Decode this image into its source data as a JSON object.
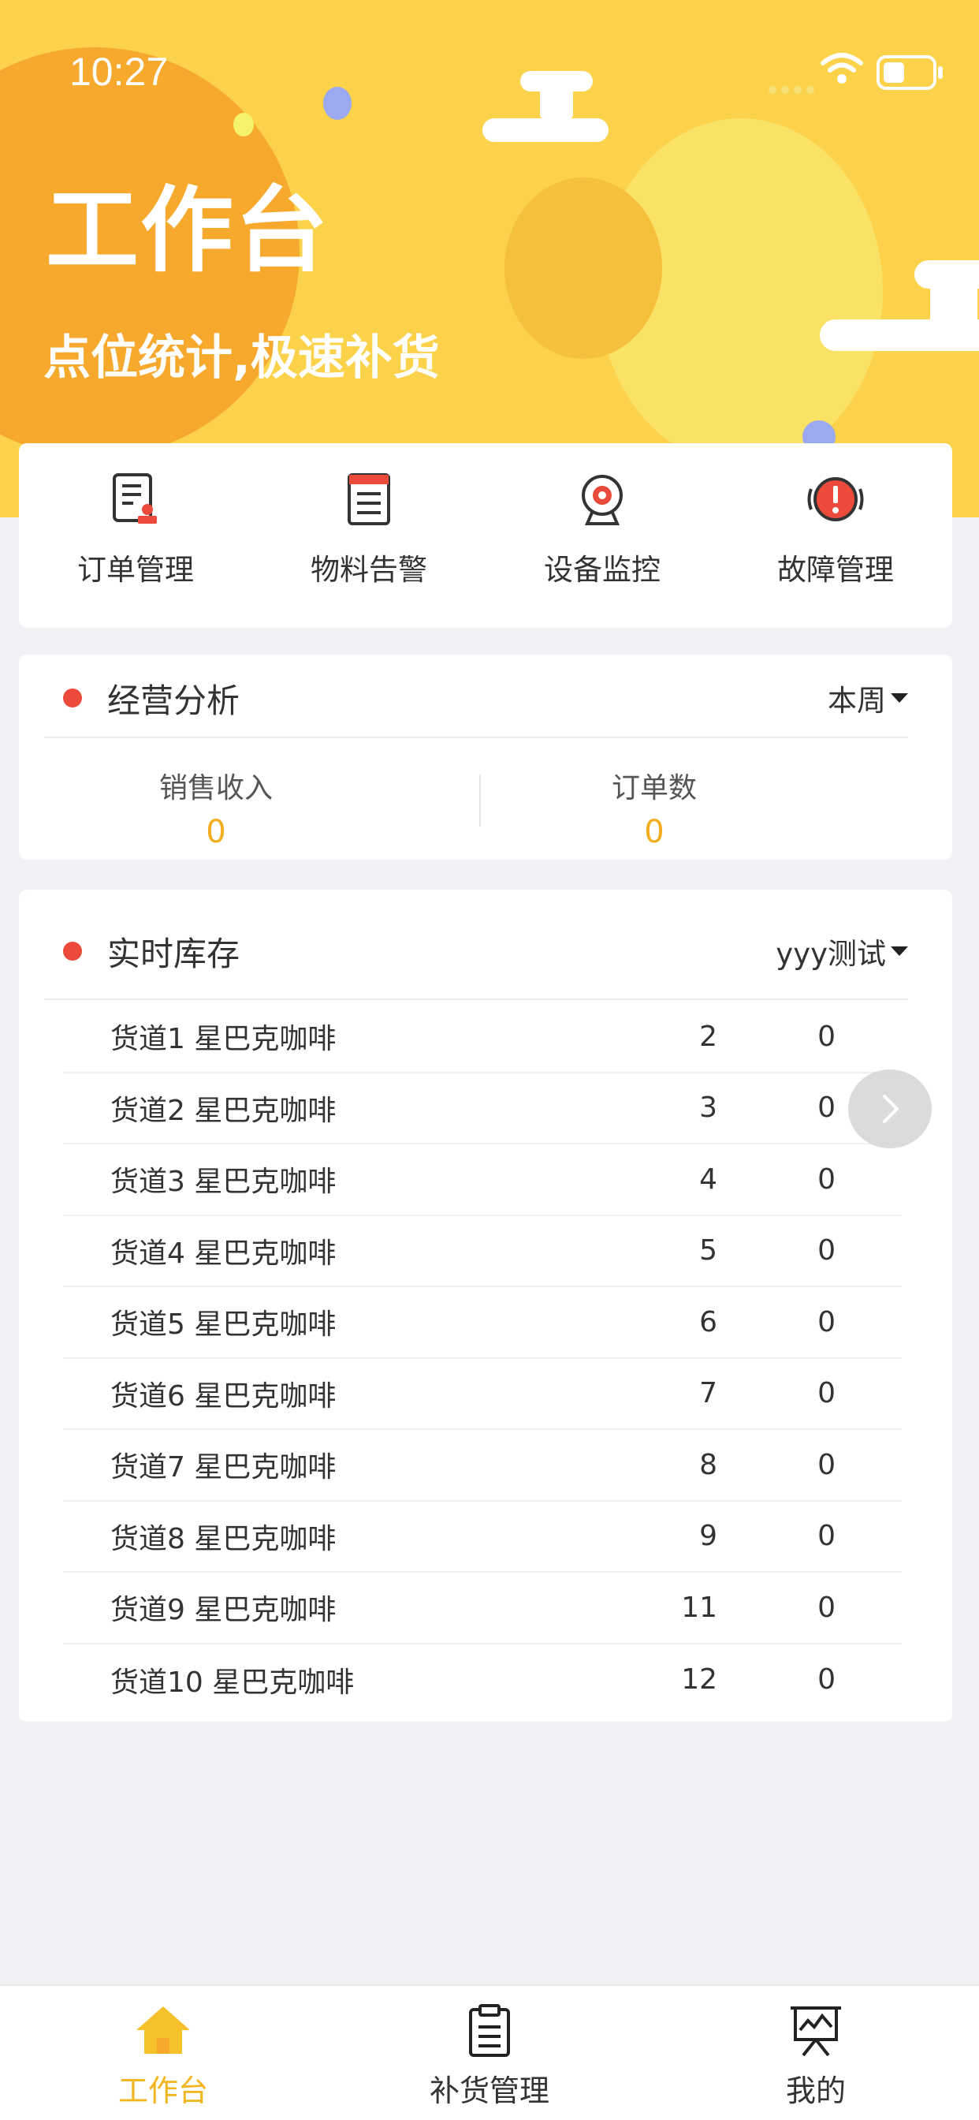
{
  "status_bar": {
    "time": "10:27"
  },
  "header": {
    "title": "工作台",
    "subtitle": "点位统计,极速补货"
  },
  "quick_actions": [
    {
      "label": "订单管理",
      "icon": "order-icon"
    },
    {
      "label": "物料告警",
      "icon": "material-alert-icon"
    },
    {
      "label": "设备监控",
      "icon": "camera-icon"
    },
    {
      "label": "故障管理",
      "icon": "alarm-icon"
    }
  ],
  "business": {
    "title": "经营分析",
    "period": "本周",
    "sales_label": "销售收入",
    "sales_value": "0",
    "orders_label": "订单数",
    "orders_value": "0"
  },
  "stock": {
    "title": "实时库存",
    "selector": "yyy测试",
    "rows": [
      {
        "name": "货道1 星巴克咖啡",
        "qty": "2",
        "value": "0"
      },
      {
        "name": "货道2 星巴克咖啡",
        "qty": "3",
        "value": "0"
      },
      {
        "name": "货道3 星巴克咖啡",
        "qty": "4",
        "value": "0"
      },
      {
        "name": "货道4 星巴克咖啡",
        "qty": "5",
        "value": "0"
      },
      {
        "name": "货道5 星巴克咖啡",
        "qty": "6",
        "value": "0"
      },
      {
        "name": "货道6 星巴克咖啡",
        "qty": "7",
        "value": "0"
      },
      {
        "name": "货道7 星巴克咖啡",
        "qty": "8",
        "value": "0"
      },
      {
        "name": "货道8 星巴克咖啡",
        "qty": "9",
        "value": "0"
      },
      {
        "name": "货道9 星巴克咖啡",
        "qty": "11",
        "value": "0"
      },
      {
        "name": "货道10 星巴克咖啡",
        "qty": "12",
        "value": "0"
      }
    ]
  },
  "tabbar": [
    {
      "label": "工作台",
      "icon": "home-icon",
      "active": true
    },
    {
      "label": "补货管理",
      "icon": "clipboard-icon",
      "active": false
    },
    {
      "label": "我的",
      "icon": "presentation-icon",
      "active": false
    }
  ],
  "colors": {
    "header_bg": "#fbd24a",
    "accent": "#f2b51e",
    "dot": "#ec4a3a",
    "metric_value": "#f2ad1e"
  }
}
